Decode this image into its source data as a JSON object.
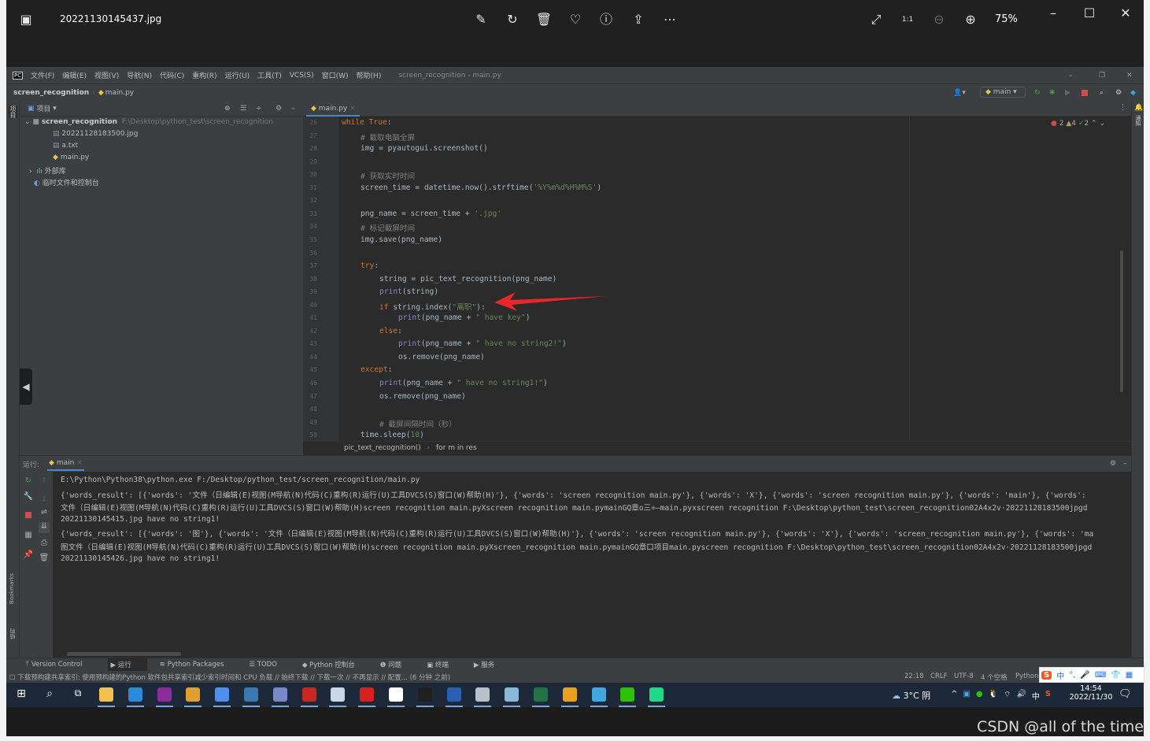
{
  "viewer": {
    "filename": "20221130145437.jpg",
    "zoom": "75%",
    "toolbar_icons": [
      "edit-icon",
      "rotate-icon",
      "delete-icon",
      "favorite-icon",
      "info-icon",
      "share-icon",
      "more-icon"
    ],
    "right_icons": [
      "fullscreen-icon",
      "actual-size-icon",
      "zoom-out-icon",
      "zoom-in-icon"
    ]
  },
  "ide": {
    "menu": [
      "文件(F)",
      "编辑(E)",
      "视图(V)",
      "导航(N)",
      "代码(C)",
      "重构(R)",
      "运行(U)",
      "工具(T)",
      "VCS(S)",
      "窗口(W)",
      "帮助(H)"
    ],
    "window_title": "screen_recognition - main.py",
    "nav": {
      "project": "screen_recognition",
      "file": "main.py"
    },
    "run_config": "main",
    "project_panel": {
      "title": "项目",
      "root": "screen_recognition",
      "root_path": "F:\\Desktop\\python_test\\screen_recognition",
      "files": [
        "20221128183500.jpg",
        "a.txt",
        "main.py"
      ],
      "external": "外部库",
      "scratches": "临时文件和控制台"
    },
    "left_strip_label": "项目",
    "right_strip_label": "通知",
    "editor": {
      "tab": "main.py",
      "inspections": {
        "errors": "2",
        "warnings": "4",
        "ok": "2"
      },
      "lines": [
        {
          "n": "26",
          "indent": 0,
          "seg": [
            [
              "while True",
              "kw"
            ],
            [
              ":",
              ""
            ]
          ]
        },
        {
          "n": "27",
          "indent": 1,
          "seg": [
            [
              "# 截取电脑全屏",
              "com"
            ]
          ]
        },
        {
          "n": "28",
          "indent": 1,
          "seg": [
            [
              "img = pyautogui.screenshot()",
              ""
            ]
          ]
        },
        {
          "n": "29",
          "indent": 0,
          "seg": []
        },
        {
          "n": "30",
          "indent": 1,
          "seg": [
            [
              "# 获取实时时间",
              "com"
            ]
          ]
        },
        {
          "n": "31",
          "indent": 1,
          "seg": [
            [
              "screen_time = datetime.now().strftime(",
              ""
            ],
            [
              "'%Y%m%d%H%M%S'",
              "str"
            ],
            [
              ")",
              ""
            ]
          ]
        },
        {
          "n": "32",
          "indent": 0,
          "seg": []
        },
        {
          "n": "33",
          "indent": 1,
          "seg": [
            [
              "png_name = screen_time + ",
              ""
            ],
            [
              "'.jpg'",
              "str"
            ]
          ]
        },
        {
          "n": "34",
          "indent": 1,
          "seg": [
            [
              "# 标记截屏时间",
              "com"
            ]
          ]
        },
        {
          "n": "35",
          "indent": 1,
          "seg": [
            [
              "img.save(png_name)",
              ""
            ]
          ]
        },
        {
          "n": "36",
          "indent": 0,
          "seg": []
        },
        {
          "n": "37",
          "indent": 1,
          "seg": [
            [
              "try",
              "kw"
            ],
            [
              ":",
              ""
            ]
          ]
        },
        {
          "n": "38",
          "indent": 2,
          "seg": [
            [
              "string = pic_text_recognition(png_name)",
              ""
            ]
          ]
        },
        {
          "n": "39",
          "indent": 2,
          "seg": [
            [
              "print",
              "bi"
            ],
            [
              "(string)",
              ""
            ]
          ]
        },
        {
          "n": "40",
          "indent": 2,
          "seg": [
            [
              "if ",
              "kw"
            ],
            [
              "string.index(",
              ""
            ],
            [
              "\"离职\"",
              "str"
            ],
            [
              "):",
              ""
            ]
          ]
        },
        {
          "n": "41",
          "indent": 3,
          "seg": [
            [
              "print",
              "bi"
            ],
            [
              "(png_name + ",
              ""
            ],
            [
              "\" have key\"",
              "str"
            ],
            [
              ")",
              ""
            ]
          ]
        },
        {
          "n": "42",
          "indent": 2,
          "seg": [
            [
              "else",
              "kw"
            ],
            [
              ":",
              ""
            ]
          ]
        },
        {
          "n": "43",
          "indent": 3,
          "seg": [
            [
              "print",
              "bi"
            ],
            [
              "(png_name + ",
              ""
            ],
            [
              "\" have no string2!\"",
              "str"
            ],
            [
              ")",
              ""
            ]
          ]
        },
        {
          "n": "44",
          "indent": 3,
          "seg": [
            [
              "os.remove(png_name)",
              ""
            ]
          ]
        },
        {
          "n": "45",
          "indent": 1,
          "seg": [
            [
              "except",
              "kw"
            ],
            [
              ":",
              ""
            ]
          ]
        },
        {
          "n": "46",
          "indent": 2,
          "seg": [
            [
              "print",
              "bi"
            ],
            [
              "(png_name + ",
              ""
            ],
            [
              "\" have no string1!\"",
              "str"
            ],
            [
              ")",
              ""
            ]
          ]
        },
        {
          "n": "47",
          "indent": 2,
          "seg": [
            [
              "os.remove(png_name)",
              ""
            ]
          ]
        },
        {
          "n": "48",
          "indent": 0,
          "seg": []
        },
        {
          "n": "49",
          "indent": 2,
          "seg": [
            [
              "# 截屏间隔时间（秒）",
              "com"
            ]
          ]
        },
        {
          "n": "50",
          "indent": 1,
          "seg": [
            [
              "time.sleep(",
              ""
            ],
            [
              "10",
              "str"
            ],
            [
              ")",
              ""
            ]
          ]
        }
      ],
      "breadcrumb": [
        "pic_text_recognition()",
        "for m in res"
      ]
    },
    "run": {
      "label": "运行:",
      "tab": "main",
      "output": [
        "E:\\Python\\Python38\\python.exe F:/Desktop/python_test/screen_recognition/main.py",
        "{'words_result': [{'words': '文件（日编辑(E)视图(M导航(N)代码(C)重构(R)运行(U)工具DVCS(S)窗口(W)帮助(H)'}, {'words': 'screen recognition main.py'}, {'words': 'X'}, {'words': 'screen recognition main.py'}, {'words': 'main'}, {'words':",
        "文件（日编辑(E)视图(M导航(N)代码(C)重构(R)运行(U)工具DVCS(S)窗口(W)帮助(H)screen recognition main.pyXscreen recognition main.pymainGQ章o三÷—main.pyxscreen recognition F:\\Desktop\\python_test\\screen_recognition02A4x2v·20221128183500jpgd",
        "20221130145415.jpg have no string1!",
        "{'words_result': [{'words': '图'}, {'words': '文件（日编辑(E)视图(M导航(N)代码(C)重构(R)运行(U)工具DVCS(S)窗口(W)帮助(H)'}, {'words': 'screen recognition main.py'}, {'words': 'X'}, {'words': 'screen_recognition main.py'}, {'words': 'ma",
        "图文件（日编辑(E)视图(M导航(N)代码(C)重构(R)运行(U)工具DVCS(S)窗口(W)帮助(H)screen recognition main.pyXscreen_recognition main.pymainGQ章口项目main.pyscreen recognition F:\\Desktop\\python_test\\screen_recognition02A4x2v·20221128183500jpgd",
        "20221130145426.jpg have no string1!"
      ]
    },
    "left_strip_bottom": [
      "Bookmarks",
      "结构"
    ],
    "tool_tabs": [
      "Version Control",
      "运行",
      "Python Packages",
      "TODO",
      "Python 控制台",
      "问题",
      "终端",
      "服务"
    ],
    "status": {
      "message": "下载预构建共享索引: 使用预构建的Python 软件包共享索引减少索引时间和 CPU 负载 // 始终下载 // 下载一次 // 不再显示 // 配置... (6 分钟 之前)",
      "position": "22:18",
      "line_sep": "CRLF",
      "encoding": "UTF-8",
      "indent": "4 个空格",
      "interpreter": "Python"
    }
  },
  "ime": {
    "mode": "中",
    "items": [
      "°,",
      "mic-icon",
      "keyboard-icon",
      "skin-icon",
      "apps-icon"
    ]
  },
  "taskbar": {
    "apps": [
      {
        "name": "file-explorer",
        "color": "#f2c14e"
      },
      {
        "name": "vscode",
        "color": "#2c8ad8"
      },
      {
        "name": "pen-app",
        "color": "#8a2c9a"
      },
      {
        "name": "chrome",
        "color": "#e0a030"
      },
      {
        "name": "notes",
        "color": "#4f8ff0"
      },
      {
        "name": "graduation",
        "color": "#3a78b0"
      },
      {
        "name": "buildings",
        "color": "#7a8ac8"
      },
      {
        "name": "atk-xcom",
        "color": "#c8281e"
      },
      {
        "name": "xinchip",
        "color": "#c8d8e8"
      },
      {
        "name": "hp-app",
        "color": "#d82020"
      },
      {
        "name": "cloud-app",
        "color": "#ffffff"
      },
      {
        "name": "spider",
        "color": "#202020"
      },
      {
        "name": "word",
        "color": "#2b5fb4"
      },
      {
        "name": "window-app",
        "color": "#b8c0c8"
      },
      {
        "name": "notepad",
        "color": "#8ab8d8"
      },
      {
        "name": "excel-like",
        "color": "#217346"
      },
      {
        "name": "box-app",
        "color": "#e8a020"
      },
      {
        "name": "search-app",
        "color": "#40a8e0"
      },
      {
        "name": "wechat",
        "color": "#2dc100"
      },
      {
        "name": "pycharm",
        "color": "#21d789"
      }
    ],
    "weather": "3°C 阴",
    "ime": "中",
    "time": "14:54",
    "date": "2022/11/30"
  },
  "watermark": "CSDN @all of the time",
  "colors": {
    "keyword": "#cc7832",
    "string": "#6a8759",
    "comment": "#808080",
    "builtin": "#8888c6",
    "annotation_arrow": "#e8262b"
  }
}
